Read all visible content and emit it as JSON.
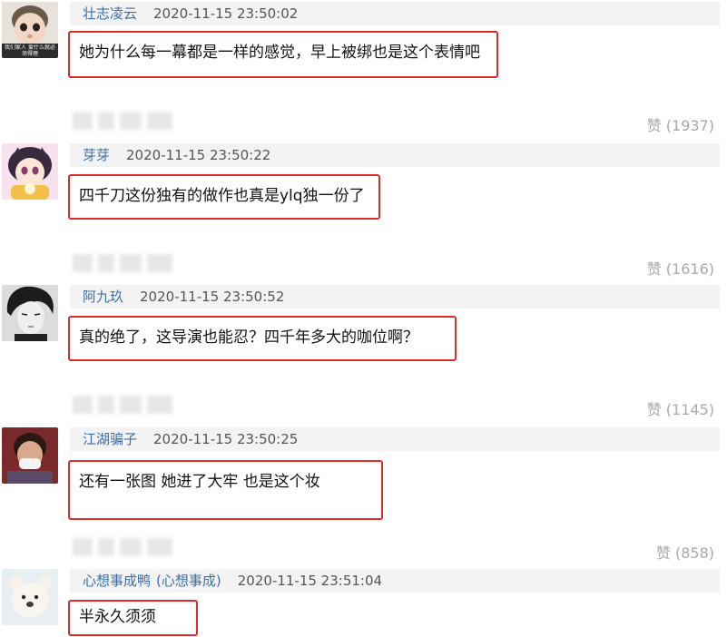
{
  "comments": [
    {
      "username": "壮志凌云",
      "time": "2020-11-15 23:50:02",
      "content": "她为什么每一幕都是一样的感觉，早上被绑也是这个表情吧",
      "likes": "赞 (1937)",
      "avatar": "baby-avatar",
      "avatar_caption": "我们家人 爱什么就必须得理"
    },
    {
      "username": "芽芽",
      "time": "2020-11-15 23:50:22",
      "content": "四千刀这份独有的做作也真是ylq独一份了",
      "likes": "赞 (1616)",
      "avatar": "anime-girl-avatar"
    },
    {
      "username": "阿九玖",
      "time": "2020-11-15 23:50:52",
      "content": "真的绝了，这导演也能忍？四千年多大的咖位啊？",
      "likes": "赞 (1145)",
      "avatar": "dark-hair-man-avatar"
    },
    {
      "username": "江湖骗子",
      "time": "2020-11-15 23:50:25",
      "content": "还有一张图 她进了大牢 也是这个妆",
      "likes": "赞 (858)",
      "avatar": "masked-woman-avatar"
    },
    {
      "username": "心想事成鸭",
      "username_alt": "(心想事成)",
      "time": "2020-11-15 23:51:04",
      "content": "半永久须须",
      "avatar": "teddy-bear-avatar"
    }
  ],
  "colors": {
    "username": "#3b6ea5",
    "highlight_border": "#e12a2a",
    "meta_background": "#f3f3f3",
    "likes_text": "#a9a9a9"
  }
}
